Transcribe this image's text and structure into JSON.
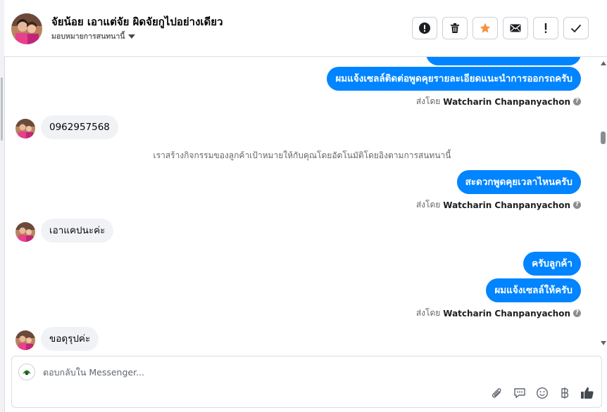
{
  "header": {
    "contact_name": "จัยน้อย เอาแต่จัย ผิดจัยกูไปอย่างเดียว",
    "assign_label": "มอบหมายการสนทนานี้",
    "actions": [
      {
        "name": "mark-spam-button",
        "icon": "alert-circle-icon"
      },
      {
        "name": "delete-button",
        "icon": "trash-icon"
      },
      {
        "name": "star-button",
        "icon": "star-icon",
        "color": "#f7923b"
      },
      {
        "name": "mark-unread-button",
        "icon": "envelope-icon"
      },
      {
        "name": "follow-up-button",
        "icon": "exclamation-icon"
      },
      {
        "name": "mark-done-button",
        "icon": "check-icon"
      }
    ]
  },
  "conversation": {
    "outgoing_1": "ผมแจ้งเซลล์ติดต่อพูดคุยรายละเอียดแนะนำการออกรถครับ",
    "sent_by_1": {
      "prefix": "ส่งโดย",
      "name": "Watcharin Chanpanyachon"
    },
    "incoming_1": "0962957568",
    "system_note": "เราสร้างกิจกรรมของลูกค้าเป้าหมายให้กับคุณโดยอัตโนมัติโดยอิงตามการสนทนานี้",
    "outgoing_2": "สะดวกพูดคุยเวลาไหนครับ",
    "sent_by_2": {
      "prefix": "ส่งโดย",
      "name": "Watcharin Chanpanyachon"
    },
    "incoming_2": "เอาแคปนะค่ะ",
    "outgoing_3": "ครับลูกค้า",
    "outgoing_4": "ผมแจ้งเซลล์ให้ครับ",
    "sent_by_3": {
      "prefix": "ส่งโดย",
      "name": "Watcharin Chanpanyachon"
    },
    "incoming_3": "ขอดุรุปค่ะ"
  },
  "composer": {
    "placeholder": "ตอบกลับใน Messenger...",
    "tools": [
      "paperclip-icon",
      "saved-reply-icon",
      "emoji-icon",
      "baht-payment-icon",
      "like-icon"
    ]
  },
  "colors": {
    "accent": "#0084ff",
    "incoming_bubble": "#f0f2f5",
    "star": "#f7923b"
  }
}
